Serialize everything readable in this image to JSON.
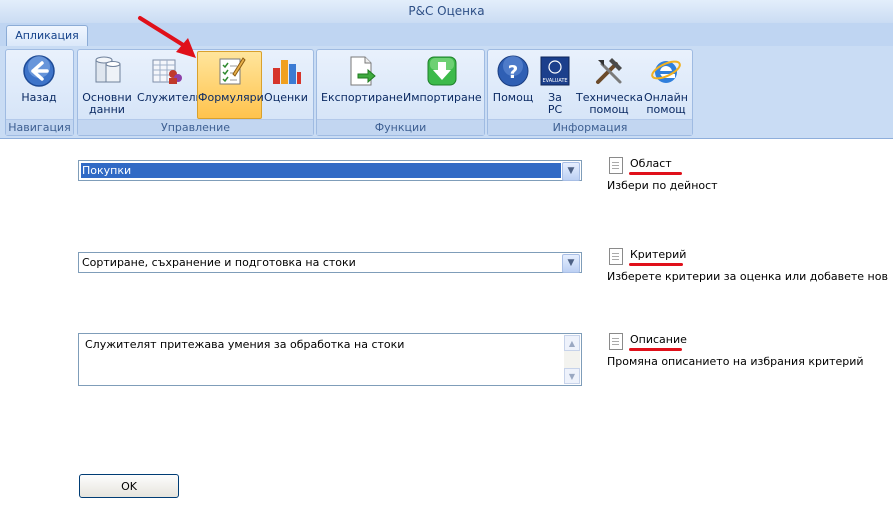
{
  "window": {
    "title": "P&C Оценка"
  },
  "tabs": [
    {
      "label": "Апликация"
    }
  ],
  "ribbon": {
    "groups": [
      {
        "label": "Навигация",
        "buttons": [
          {
            "label": "Назад",
            "icon": "back-arrow-icon"
          }
        ]
      },
      {
        "label": "Управление",
        "buttons": [
          {
            "label": "Основни\nданни",
            "icon": "database-icon"
          },
          {
            "label": "Служители",
            "icon": "employees-icon"
          },
          {
            "label": "Формуляри",
            "icon": "forms-icon",
            "active": true
          },
          {
            "label": "Оценки",
            "icon": "bar-chart-icon"
          }
        ]
      },
      {
        "label": "Функции",
        "buttons": [
          {
            "label": "Експортиране",
            "icon": "export-icon"
          },
          {
            "label": "Импортиране",
            "icon": "import-icon"
          }
        ]
      },
      {
        "label": "Информация",
        "buttons": [
          {
            "label": "Помощ",
            "icon": "help-icon"
          },
          {
            "label": "За\nPC",
            "icon": "about-icon"
          },
          {
            "label": "Техническа\nпомощ",
            "icon": "tools-icon"
          },
          {
            "label": "Онлайн\nпомощ",
            "icon": "internet-explorer-icon"
          }
        ]
      }
    ],
    "about_logo_text": "EVALUATE"
  },
  "form": {
    "area_select": {
      "value": "Покупки"
    },
    "criterion_select": {
      "value": "Сортиране, съхранение и подготовка на стоки"
    },
    "description": {
      "value": "Служителят притежава умения за обработка на стоки"
    },
    "help": {
      "area": {
        "title": "Област",
        "desc": "Избери по дейност"
      },
      "criterion": {
        "title": "Критерий",
        "desc": "Изберете критерии за оценка или добавете нов"
      },
      "description": {
        "title": "Описание",
        "desc": "Промяна описанието на избрания критерий"
      }
    },
    "ok_label": "OK"
  },
  "colors": {
    "highlight": "#316ac5",
    "annotation_red": "#e0101a",
    "active_button": "#ffc34d"
  }
}
